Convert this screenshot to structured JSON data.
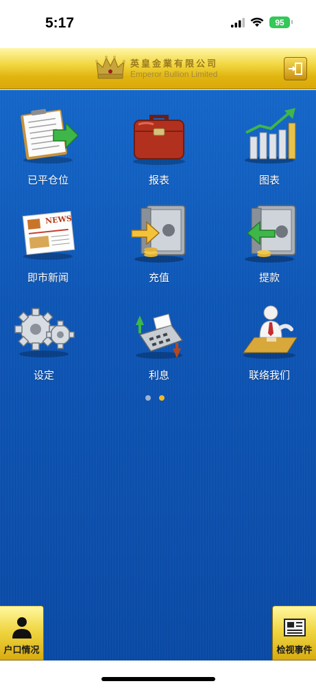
{
  "status_bar": {
    "time": "5:17",
    "battery": "95"
  },
  "header": {
    "brand_cn": "英皇金業有限公司",
    "brand_en": "Emperor Bullion Limited",
    "logout_icon": "logout-door-icon"
  },
  "menu": {
    "items": [
      {
        "label": "已平仓位",
        "icon": "closed-positions-icon"
      },
      {
        "label": "报表",
        "icon": "briefcase-icon"
      },
      {
        "label": "图表",
        "icon": "bar-chart-icon"
      },
      {
        "label": "即市新闻",
        "icon": "newspaper-icon"
      },
      {
        "label": "充值",
        "icon": "deposit-safe-icon"
      },
      {
        "label": "提款",
        "icon": "withdraw-safe-icon"
      },
      {
        "label": "设定",
        "icon": "gears-icon"
      },
      {
        "label": "利息",
        "icon": "calculator-icon"
      },
      {
        "label": "联络我们",
        "icon": "contact-person-icon"
      }
    ]
  },
  "pager": {
    "page": 1,
    "total": 2
  },
  "footer": {
    "account_label": "户口情况",
    "events_label": "检视事件"
  },
  "colors": {
    "accent_gold": "#f0d643",
    "background_blue": "#0e55b4",
    "pager_active": "#f0b72a"
  }
}
